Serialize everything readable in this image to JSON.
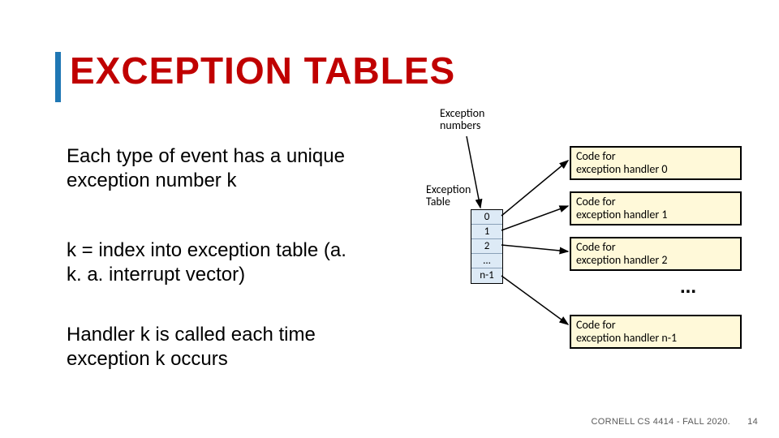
{
  "title": "EXCEPTION TABLES",
  "bullets": {
    "b1": "Each type of event has a unique exception number k",
    "b2": "k = index into exception table (a. k. a. interrupt vector)",
    "b3": "Handler k is called each time exception k occurs"
  },
  "labels": {
    "exceptionNumbers": "Exception\nnumbers",
    "exceptionTable": "Exception\nTable"
  },
  "table": {
    "rows": [
      "0",
      "1",
      "2",
      "...",
      "n-1"
    ]
  },
  "handlers": {
    "h0": "Code for\nexception handler 0",
    "h1": "Code for\nexception handler 1",
    "h2": "Code for\nexception handler 2",
    "hN": "Code for\nexception handler n-1",
    "ellipsis": "..."
  },
  "footer": {
    "course": "CORNELL CS 4414 - FALL 2020.",
    "page": "14"
  }
}
